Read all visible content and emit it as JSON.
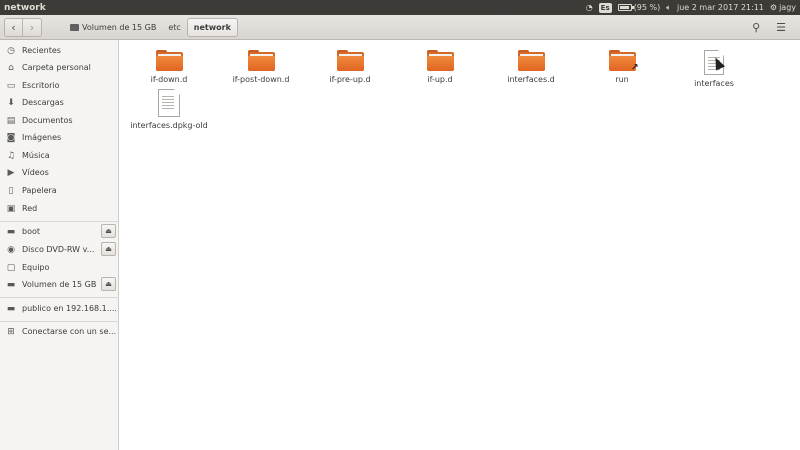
{
  "window": {
    "title": "network"
  },
  "panel": {
    "keyboard": "Es",
    "battery_text": "(95 %)",
    "battery_level": 0.95,
    "datetime": "jue 2 mar 2017 21:11",
    "user": "jagy"
  },
  "toolbar": {
    "back_icon": "chevron-left-icon",
    "forward_icon": "chevron-right-icon",
    "search_icon": "search-icon",
    "menu_icon": "hamburger-menu-icon"
  },
  "breadcrumbs": [
    {
      "label": "Volumen de 15 GB",
      "icon": "drive-icon"
    },
    {
      "label": "etc"
    },
    {
      "label": "network",
      "active": true
    }
  ],
  "sidebar": {
    "places": [
      {
        "label": "Recientes",
        "icon": "clock-icon"
      },
      {
        "label": "Carpeta personal",
        "icon": "home-icon"
      },
      {
        "label": "Escritorio",
        "icon": "desktop-folder-icon"
      },
      {
        "label": "Descargas",
        "icon": "download-icon"
      },
      {
        "label": "Documentos",
        "icon": "document-icon"
      },
      {
        "label": "Imágenes",
        "icon": "camera-icon"
      },
      {
        "label": "Música",
        "icon": "music-icon"
      },
      {
        "label": "Vídeos",
        "icon": "video-icon"
      },
      {
        "label": "Papelera",
        "icon": "trash-icon"
      },
      {
        "label": "Red",
        "icon": "network-icon"
      }
    ],
    "devices": [
      {
        "label": "boot",
        "icon": "drive-icon",
        "eject": true
      },
      {
        "label": "Disco DVD-RW v...",
        "icon": "optical-disc-icon",
        "eject": true
      },
      {
        "label": "Equipo",
        "icon": "computer-icon",
        "eject": false
      },
      {
        "label": "Volumen de 15 GB",
        "icon": "drive-icon",
        "eject": true
      }
    ],
    "network": [
      {
        "label": "publico en 192.168.1....",
        "icon": "network-drive-icon"
      }
    ],
    "connect": {
      "label": "Conectarse con un se...",
      "icon": "add-icon"
    }
  },
  "files": [
    {
      "name": "if-down.d",
      "type": "folder"
    },
    {
      "name": "if-post-down.d",
      "type": "folder"
    },
    {
      "name": "if-pre-up.d",
      "type": "folder"
    },
    {
      "name": "if-up.d",
      "type": "folder"
    },
    {
      "name": "interfaces.d",
      "type": "folder"
    },
    {
      "name": "run",
      "type": "folder-link"
    },
    {
      "name": "interfaces",
      "type": "text-file"
    },
    {
      "name": "interfaces.dpkg-old",
      "type": "text-file"
    }
  ]
}
